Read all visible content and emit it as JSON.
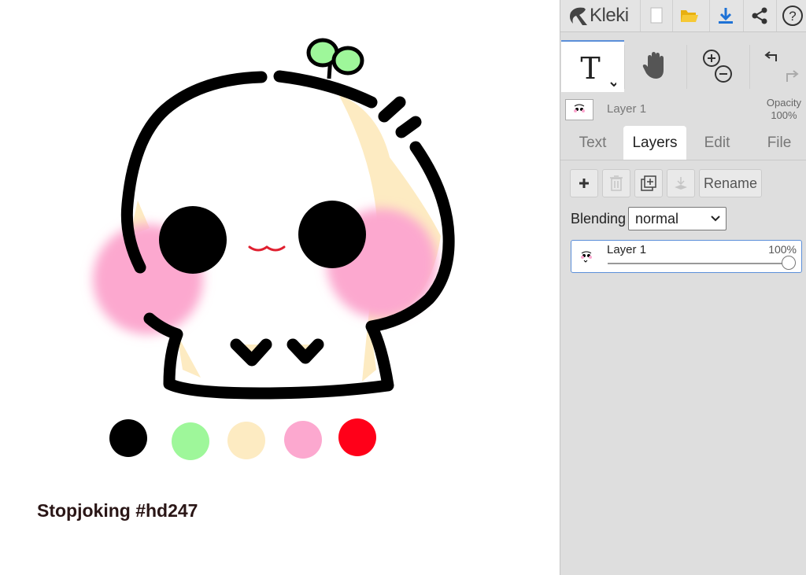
{
  "app": {
    "name": "Kleki"
  },
  "toolbar": {
    "new_icon": "new-file-icon",
    "open_icon": "open-folder-icon",
    "save_icon": "download-icon",
    "share_icon": "share-icon",
    "help_icon": "help-icon",
    "tools": [
      {
        "name": "text-tool",
        "icon": "T",
        "active": true
      },
      {
        "name": "hand-tool",
        "icon": "hand-icon"
      },
      {
        "name": "zoom",
        "icon": "zoom-icon"
      },
      {
        "name": "undo-redo",
        "icon": "undo-icon"
      }
    ]
  },
  "layer_info": {
    "name": "Layer 1",
    "opacity_label": "Opacity",
    "opacity_value": "100%"
  },
  "tabs": [
    {
      "label": "Text"
    },
    {
      "label": "Layers",
      "active": true
    },
    {
      "label": "Edit"
    },
    {
      "label": "File"
    }
  ],
  "layers_panel": {
    "rename_label": "Rename",
    "blending_label": "Blending",
    "blending_value": "normal",
    "layers": [
      {
        "name": "Layer 1",
        "opacity": "100%",
        "opacity_fraction": 1.0
      }
    ]
  },
  "canvas": {
    "caption": "Stopjoking #hd247",
    "palette": [
      "#000000",
      "#9ef79a",
      "#fdebc2",
      "#fca8cf",
      "#ff0019"
    ]
  },
  "colors": {
    "accent": "#5b8fd9",
    "panel_bg": "#dedede",
    "save_blue": "#1e72d6",
    "open_yellow": "#f2bf1b"
  }
}
